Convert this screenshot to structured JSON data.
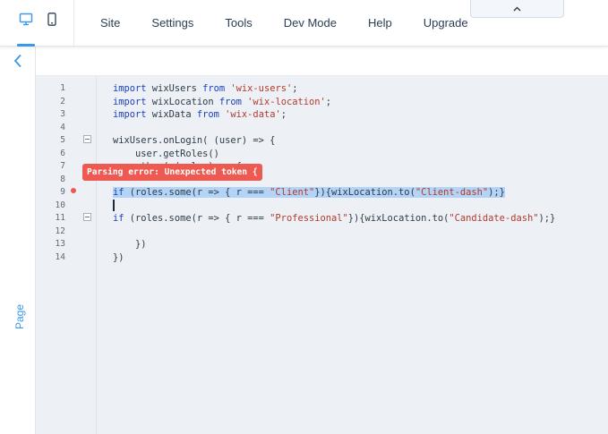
{
  "topbar": {
    "menu": [
      "Site",
      "Settings",
      "Tools",
      "Dev Mode",
      "Help",
      "Upgrade"
    ],
    "devices": {
      "desktop": "desktop-icon",
      "mobile": "mobile-icon",
      "active": "desktop"
    },
    "collapse_icon": "chevron-up-icon"
  },
  "left_panel": {
    "back_icon": "chevron-left-icon",
    "page_label": "Page"
  },
  "editor": {
    "line_numbers": [
      "1",
      "2",
      "3",
      "4",
      "5",
      "6",
      "7",
      "8",
      "9",
      "10",
      "11",
      "12",
      "13",
      "14"
    ],
    "folded_lines": [
      5,
      11
    ],
    "error_line": 9,
    "error_message": "Parsing error: Unexpected token {",
    "lines": {
      "l1": {
        "a": "import",
        "b": " wixUsers ",
        "c": "from",
        "d": " ",
        "e": "'wix-users'",
        "f": ";"
      },
      "l2": {
        "a": "import",
        "b": " wixLocation ",
        "c": "from",
        "d": " ",
        "e": "'wix-location'",
        "f": ";"
      },
      "l3": {
        "a": "import",
        "b": " wixData ",
        "c": "from",
        "d": " ",
        "e": "'wix-data'",
        "f": ";"
      },
      "l5": "wixUsers.onLogin( (user) => {",
      "l6": "    user.getRoles()",
      "l7": "    .then( (roles) => {",
      "l9": {
        "a": "if",
        "b": " (roles.some(r => { r === ",
        "c": "\"Client\"",
        "d": "}){wixLocation.to(",
        "e": "\"Client-dash\"",
        "f": ");}"
      },
      "l11": {
        "a": "if",
        "b": " (roles.some(r => { r === ",
        "c": "\"Professional\"",
        "d": "}){wixLocation.to(",
        "e": "\"Candidate-dash\"",
        "f": ");}"
      },
      "l13": "    })",
      "l14": "})"
    }
  },
  "colors": {
    "accent": "#3899ec",
    "error": "#ee5951",
    "selection": "#b3d3f7",
    "editor_bg": "#edf1f5"
  }
}
